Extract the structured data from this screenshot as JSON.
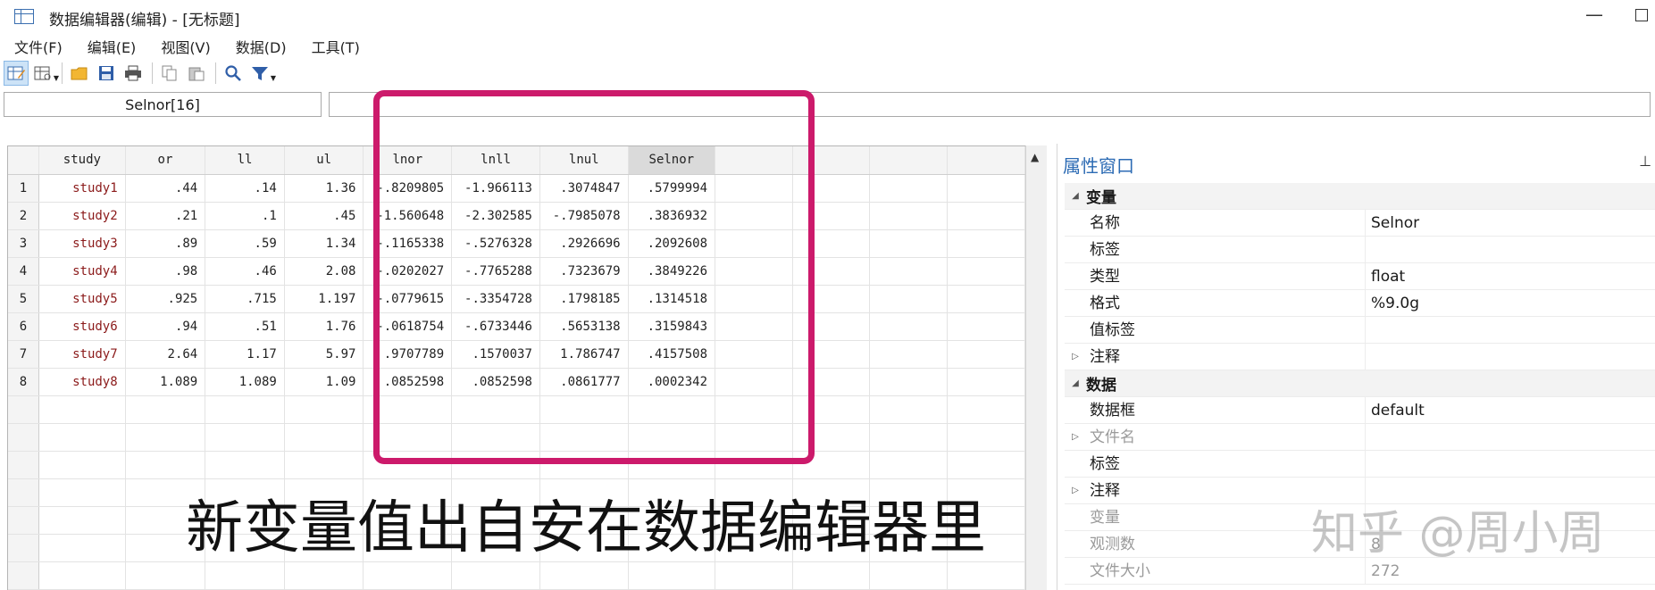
{
  "window": {
    "title": "数据编辑器(编辑) - [无标题]",
    "minimize": "—"
  },
  "menu": [
    "文件(F)",
    "编辑(E)",
    "视图(V)",
    "数据(D)",
    "工具(T)"
  ],
  "cellbar": {
    "name": "Selnor[16]",
    "value": ""
  },
  "grid": {
    "columns": [
      "study",
      "or",
      "ll",
      "ul",
      "lnor",
      "lnll",
      "lnul",
      "Selnor"
    ],
    "rows": [
      [
        "1",
        "study1",
        ".44",
        ".14",
        "1.36",
        "-.8209805",
        "-1.966113",
        ".3074847",
        ".5799994"
      ],
      [
        "2",
        "study2",
        ".21",
        ".1",
        ".45",
        "-1.560648",
        "-2.302585",
        "-.7985078",
        ".3836932"
      ],
      [
        "3",
        "study3",
        ".89",
        ".59",
        "1.34",
        "-.1165338",
        "-.5276328",
        ".2926696",
        ".2092608"
      ],
      [
        "4",
        "study4",
        ".98",
        ".46",
        "2.08",
        "-.0202027",
        "-.7765288",
        ".7323679",
        ".3849226"
      ],
      [
        "5",
        "study5",
        ".925",
        ".715",
        "1.197",
        "-.0779615",
        "-.3354728",
        ".1798185",
        ".1314518"
      ],
      [
        "6",
        "study6",
        ".94",
        ".51",
        "1.76",
        "-.0618754",
        "-.6733446",
        ".5653138",
        ".3159843"
      ],
      [
        "7",
        "study7",
        "2.64",
        "1.17",
        "5.97",
        ".9707789",
        ".1570037",
        "1.786747",
        ".4157508"
      ],
      [
        "8",
        "study8",
        "1.089",
        "1.089",
        "1.09",
        ".0852598",
        ".0852598",
        ".0861777",
        ".0002342"
      ]
    ]
  },
  "annotation": "新变量值出自安在数据编辑器里",
  "properties": {
    "title": "属性窗口",
    "sections": [
      {
        "label": "变量",
        "rows": [
          {
            "key": "名称",
            "value": "Selnor"
          },
          {
            "key": "标签",
            "value": ""
          },
          {
            "key": "类型",
            "value": "float"
          },
          {
            "key": "格式",
            "value": "%9.0g"
          },
          {
            "key": "值标签",
            "value": ""
          },
          {
            "key": "注释",
            "value": "",
            "expandable": true
          }
        ]
      },
      {
        "label": "数据",
        "rows": [
          {
            "key": "数据框",
            "value": "default"
          },
          {
            "key": "文件名",
            "value": "",
            "expandable": true,
            "dim": true
          },
          {
            "key": "标签",
            "value": ""
          },
          {
            "key": "注释",
            "value": "",
            "expandable": true
          },
          {
            "key": "变量",
            "value": "",
            "dim": true
          },
          {
            "key": "观测数",
            "value": "8",
            "dim": true
          },
          {
            "key": "文件大小",
            "value": "272",
            "dim": true
          }
        ]
      }
    ]
  },
  "watermark": "知乎 @周小周",
  "colors": {
    "highlight": "#cc1a6b",
    "accent": "#2c6bb4",
    "string_values": "#8b1a1a"
  }
}
